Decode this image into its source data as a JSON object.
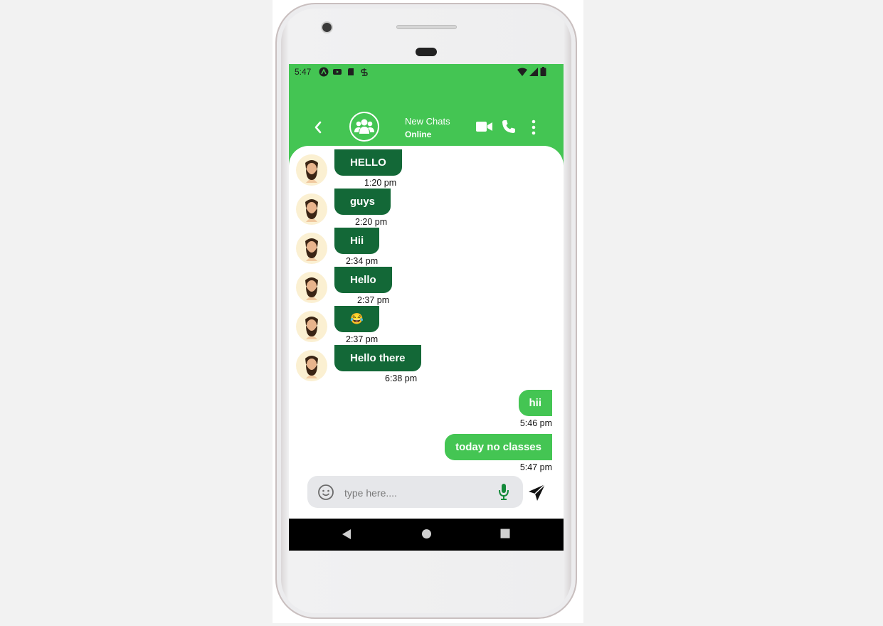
{
  "status_bar": {
    "time": "5:47",
    "left_icons": [
      "app-a-icon",
      "youtube-icon",
      "sd-card-icon",
      "sync-icon"
    ],
    "right_icons": [
      "wifi-icon",
      "signal-icon",
      "battery-icon"
    ]
  },
  "header": {
    "title": "New Chats",
    "status": "Online",
    "colors": {
      "accent": "#44c553",
      "incoming_bubble": "#136837"
    }
  },
  "messages": [
    {
      "direction": "in",
      "text": "HELLO",
      "time": "1:20 pm"
    },
    {
      "direction": "in",
      "text": "guys",
      "time": "2:20 pm"
    },
    {
      "direction": "in",
      "text": "Hii",
      "time": "2:34 pm"
    },
    {
      "direction": "in",
      "text": "Hello",
      "time": "2:37 pm"
    },
    {
      "direction": "in",
      "text": "😂",
      "time": "2:37 pm"
    },
    {
      "direction": "in",
      "text": "Hello there",
      "time": "6:38 pm"
    },
    {
      "direction": "out",
      "text": "hii",
      "time": "5:46 pm"
    },
    {
      "direction": "out",
      "text": "today no classes",
      "time": "5:47 pm"
    }
  ],
  "composer": {
    "placeholder": "type here...."
  }
}
